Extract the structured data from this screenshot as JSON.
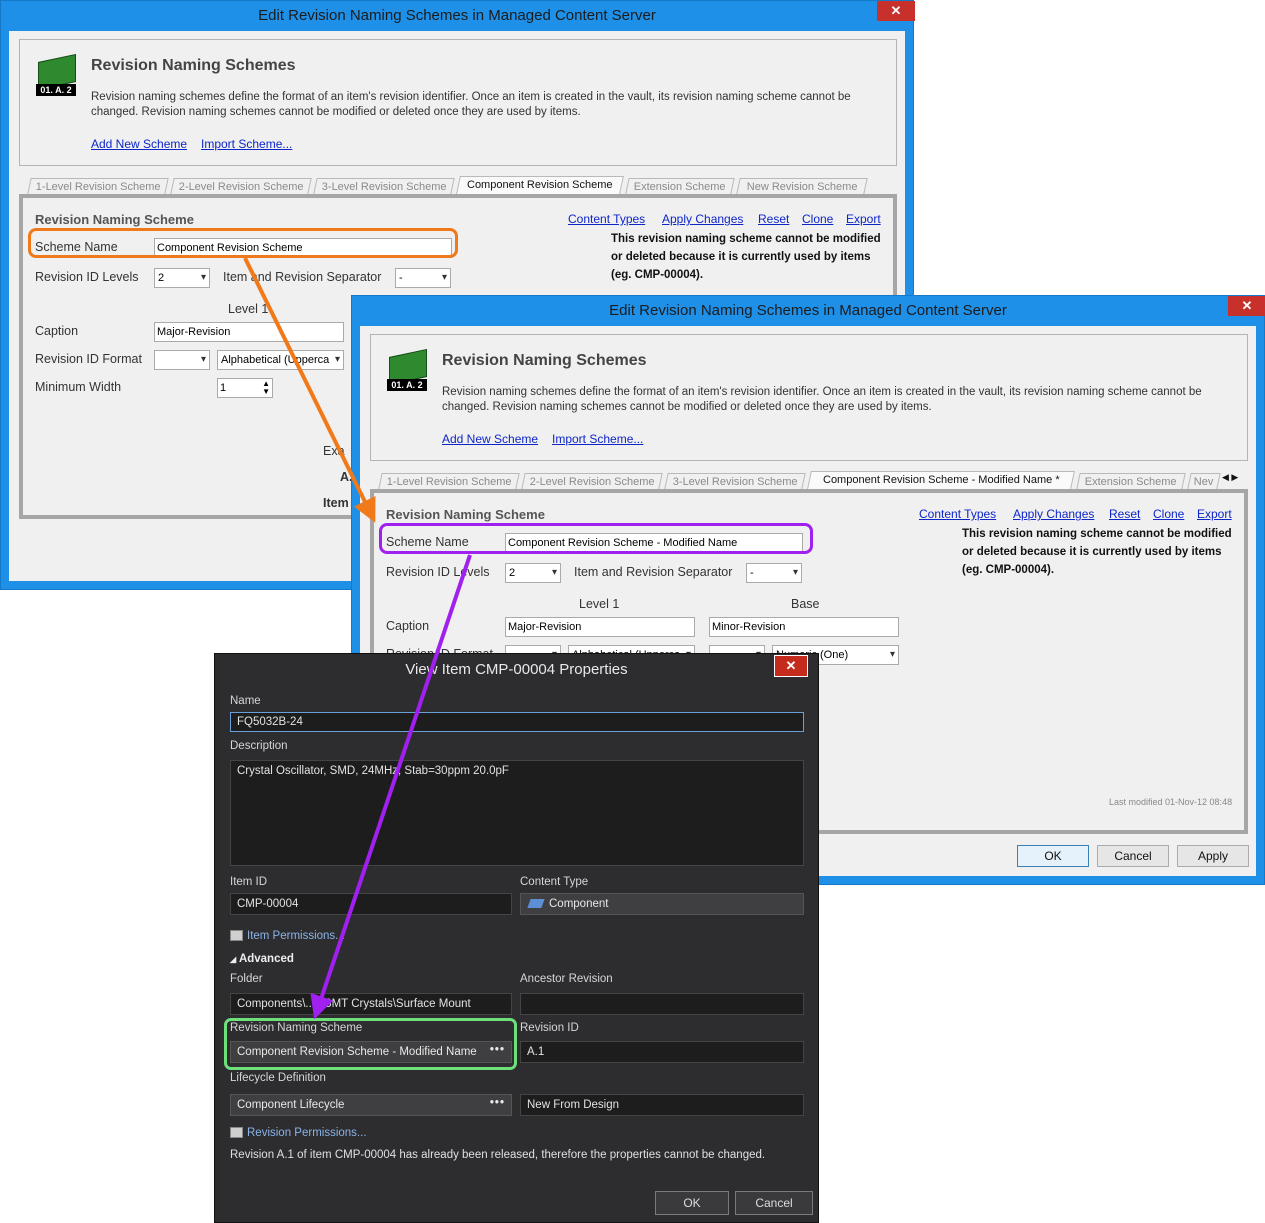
{
  "dialog1": {
    "title": "Edit Revision Naming Schemes in Managed Content Server",
    "close": "✕",
    "chip_tag": "01. A. 2",
    "header_title": "Revision Naming Schemes",
    "header_desc": "Revision naming schemes define the format of an item's revision identifier. Once an item is created in the vault, its revision naming scheme cannot be changed. Revision naming schemes cannot be modified or deleted once they are used by items.",
    "add_link": "Add New Scheme",
    "import_link": "Import Scheme...",
    "tabs": [
      "1-Level Revision Scheme",
      "2-Level Revision Scheme",
      "3-Level Revision Scheme",
      "Component Revision Scheme",
      "Extension Scheme",
      "New Revision Scheme"
    ],
    "section": "Revision Naming Scheme",
    "actions": [
      "Content Types",
      "Apply Changes",
      "Reset",
      "Clone",
      "Export"
    ],
    "scheme_name_label": "Scheme Name",
    "scheme_name": "Component Revision Scheme",
    "levels_label": "Revision ID Levels",
    "levels": "2",
    "separator_label": "Item and Revision Separator",
    "separator": "-",
    "level1_header": "Level 1",
    "caption_label": "Caption",
    "caption": "Major-Revision",
    "format_label": "Revision ID Format",
    "format": "Alphabetical (Upperca",
    "minwidth_label": "Minimum Width",
    "minwidth": "1",
    "note": "This revision naming scheme cannot be modified or deleted because it is currently used by items (eg. CMP-00004).",
    "example_partial": "Exa",
    "example_value_partial": "A.",
    "item_partial": "Item"
  },
  "dialog2": {
    "title": "Edit Revision Naming Schemes in Managed Content Server",
    "close": "✕",
    "chip_tag": "01. A. 2",
    "header_title": "Revision Naming Schemes",
    "header_desc": "Revision naming schemes define the format of an item's revision identifier. Once an item is created in the vault, its revision naming scheme cannot be changed. Revision naming schemes cannot be modified or deleted once they are used by items.",
    "add_link": "Add New Scheme",
    "import_link": "Import Scheme...",
    "tabs": [
      "1-Level Revision Scheme",
      "2-Level Revision Scheme",
      "3-Level Revision Scheme",
      "Component Revision Scheme - Modified Name *",
      "Extension Scheme",
      "Nev"
    ],
    "section": "Revision Naming Scheme",
    "actions": [
      "Content Types",
      "Apply Changes",
      "Reset",
      "Clone",
      "Export"
    ],
    "scheme_name_label": "Scheme Name",
    "scheme_name": "Component Revision Scheme - Modified Name",
    "levels_label": "Revision ID Levels",
    "levels": "2",
    "separator_label": "Item and Revision Separator",
    "separator": "-",
    "level1_header": "Level 1",
    "base_header": "Base",
    "caption_label": "Caption",
    "caption1": "Major-Revision",
    "caption2": "Minor-Revision",
    "format_label": "Revision ID Format",
    "format1": "Alphabetical (Upperca",
    "format2": "Numeric (One)",
    "format_sep": ".",
    "note": "This revision naming scheme cannot be modified or deleted because it is currently used by items (eg. CMP-00004).",
    "last_modified": "Last modified 01-Nov-12 08:48",
    "ok": "OK",
    "cancel": "Cancel",
    "apply": "Apply"
  },
  "dialog3": {
    "title": "View Item CMP-00004 Properties",
    "close": "✕",
    "name_label": "Name",
    "name": "FQ5032B-24",
    "desc_label": "Description",
    "desc": "Crystal Oscillator, SMD, 24MHz, Stab=30ppm 20.0pF",
    "itemid_label": "Item ID",
    "itemid": "CMP-00004",
    "ctype_label": "Content Type",
    "ctype": "Component",
    "item_perm": "Item Permissions...",
    "advanced": "Advanced",
    "folder_label": "Folder",
    "folder": "Components\\...x SMT Crystals\\Surface Mount",
    "ancestor_label": "Ancestor Revision",
    "ancestor": "",
    "rns_label": "Revision Naming Scheme",
    "rns": "Component Revision Scheme - Modified Name",
    "revid_label": "Revision ID",
    "revid": "A.1",
    "lifecycle_label": "Lifecycle Definition",
    "lifecycle": "Component Lifecycle",
    "lifecycle_state": "New From Design",
    "rev_perm": "Revision Permissions...",
    "footnote": "Revision A.1 of item CMP-00004 has already been released, therefore the properties cannot be changed.",
    "ok": "OK",
    "cancel": "Cancel",
    "dots": "•••"
  },
  "colors": {
    "window_frame": "#1e90e8",
    "orange_highlight": "#f07a1a",
    "purple_highlight": "#a020f0",
    "green_highlight": "#6ee07a",
    "link": "#0e26c8"
  }
}
